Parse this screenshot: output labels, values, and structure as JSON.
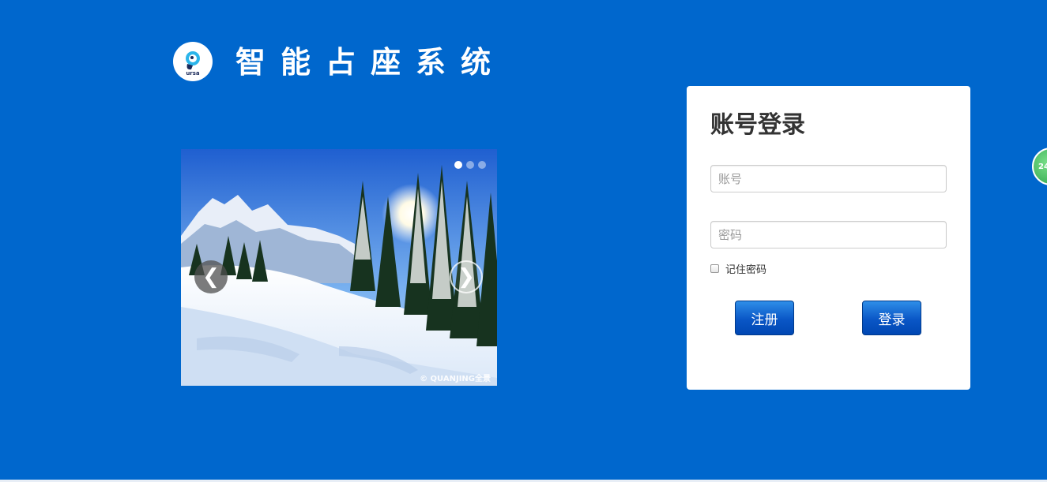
{
  "header": {
    "logo_text": "ursa",
    "title": "智能占座系统"
  },
  "carousel": {
    "slide_count": 3,
    "active_index": 0,
    "prev_glyph": "❮",
    "next_glyph": "❯",
    "watermark": "© QUANJING全景",
    "prev_icon": "chevron-left-icon",
    "next_icon": "chevron-right-icon"
  },
  "login": {
    "title": "账号登录",
    "account_placeholder": "账号",
    "account_value": "",
    "password_placeholder": "密码",
    "password_value": "",
    "remember_label": "记住密码",
    "remember_checked": false,
    "register_label": "注册",
    "login_label": "登录"
  },
  "floating_badge": {
    "text": "24"
  },
  "colors": {
    "background": "#0067cd",
    "panel": "#ffffff",
    "button": "#0a56c6",
    "badge": "#2aa14a"
  }
}
